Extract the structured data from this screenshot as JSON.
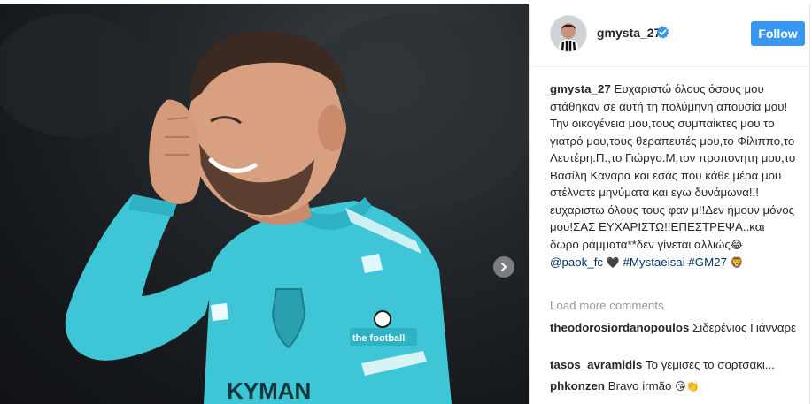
{
  "photo": {
    "next_icon": "chevron-right-icon",
    "kit_logo_text": "the football",
    "kit_text_front": "KYMAN",
    "colors": {
      "kit": "#3fc6d6",
      "background": "#1b1e21"
    }
  },
  "header": {
    "username": "gmysta_27",
    "verified_icon": "verified-badge-icon",
    "follow_label": "Follow",
    "colors": {
      "follow_bg": "#3897f0",
      "verified": "#3897f0"
    }
  },
  "caption": {
    "username": "gmysta_27",
    "text": "Ευχαριστώ όλους όσους μου στάθηκαν σε αυτή τη πολύμηνη απουσία μου!Την οικογένεια μου,τους συμπαίκτες μου,το γιατρό μου,τους θεραπευτές μου,το Φίλιππο,το Λευτέρη.Π.,το Γιώργο.Μ,τον προπονητη μου,το Βασίλη Καναρα και εσάς που κάθε μέρα μου στέλνατε μηνύματα και εγω δυνάμωνα!!!ευχαριστω όλους τους φαν μ!!Δεν ήμουν μόνος μου!ΣΑΣ ΕΥΧΑΡΙΣΤΩ!!ΕΠΕΣΤΡΕΨΑ..και δώρο ράμματα**δεν γίνεται αλλιώς",
    "laugh_emoji": "😂",
    "mention": "@paok_fc",
    "heart_emoji": "🖤",
    "hashtag_1": "#Mystaeisai",
    "hashtag_2": "#GM27",
    "lion_emoji": "🦁"
  },
  "comments": {
    "load_more_label": "Load more comments",
    "items": [
      {
        "user": "theodorosiordanopoulos",
        "text": "Σιδερένιος Γιάνναρε"
      },
      {
        "user": "tasos_avramidis",
        "text": "Το γεμισες το σορτσακι..."
      },
      {
        "user": "phkonzen",
        "text": "Bravo irmão",
        "emoji": "😘👏"
      }
    ]
  }
}
